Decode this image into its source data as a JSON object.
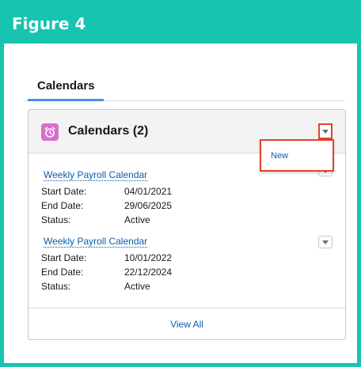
{
  "figure": {
    "label": "Figure 4"
  },
  "tabs": [
    {
      "label": "Calendars",
      "active": true
    }
  ],
  "card": {
    "title": "Calendars (2)",
    "icon": "alarm-clock-icon",
    "icon_color": "#d56fce",
    "menu": {
      "items": [
        {
          "label": "New"
        }
      ]
    },
    "records": [
      {
        "name": "Weekly Payroll Calendar",
        "fields": [
          {
            "label": "Start Date:",
            "value": "04/01/2021"
          },
          {
            "label": "End Date:",
            "value": "29/06/2025"
          },
          {
            "label": "Status:",
            "value": "Active"
          }
        ]
      },
      {
        "name": "Weekly Payroll Calendar",
        "fields": [
          {
            "label": "Start Date:",
            "value": "10/01/2022"
          },
          {
            "label": "End Date:",
            "value": "22/12/2024"
          },
          {
            "label": "Status:",
            "value": "Active"
          }
        ]
      }
    ],
    "footer_link": "View All"
  },
  "colors": {
    "frame": "#16c4b0",
    "highlight": "#e2412d",
    "link": "#0b5cab",
    "tab_underline": "#4a90e2"
  }
}
